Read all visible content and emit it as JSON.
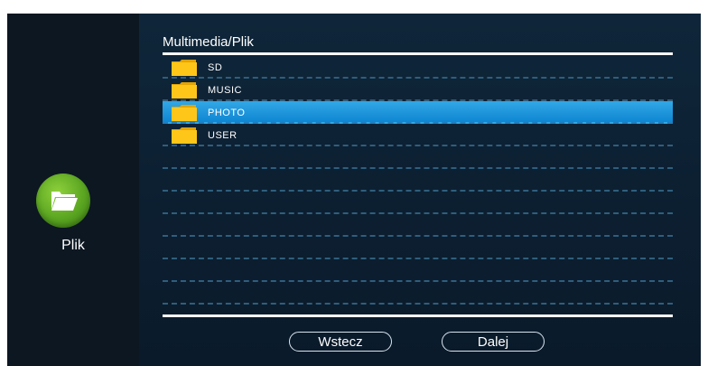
{
  "sidebar": {
    "icon": "folder-open-icon",
    "label": "Plik",
    "icon_color": "#5aa521"
  },
  "header": {
    "path": "Multimedia/Plik"
  },
  "file_list": {
    "items": [
      {
        "label": "SD",
        "icon": "folder-icon",
        "selected": false
      },
      {
        "label": "MUSIC",
        "icon": "folder-icon",
        "selected": false
      },
      {
        "label": "PHOTO",
        "icon": "folder-icon",
        "selected": true
      },
      {
        "label": "USER",
        "icon": "folder-icon",
        "selected": false
      }
    ],
    "empty_rows": 7,
    "selection_color": "#1f95de",
    "folder_color": "#ffc61a"
  },
  "buttons": {
    "back_label": "Wstecz",
    "next_label": "Dalej"
  }
}
